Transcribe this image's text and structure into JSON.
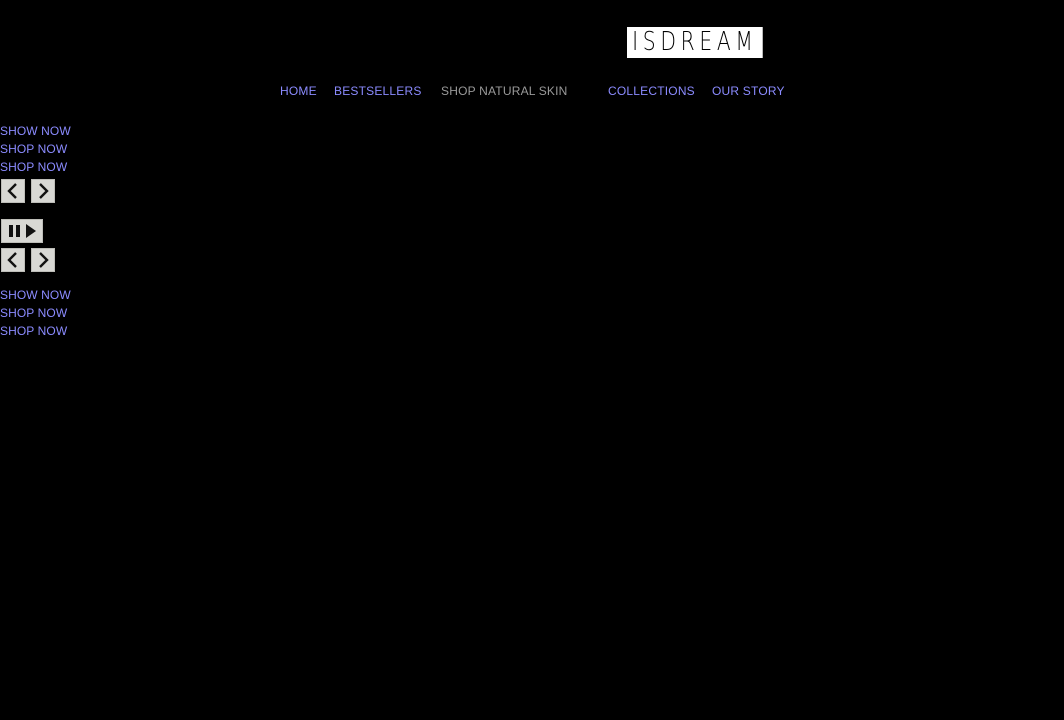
{
  "brand": {
    "logo_text": "ISDREAM"
  },
  "nav": {
    "items": [
      {
        "label": "HOME"
      },
      {
        "label": "BESTSELLERS"
      },
      {
        "label": "SHOP NATURAL SKIN"
      },
      {
        "label": "COLLECTIONS"
      },
      {
        "label": "OUR STORY"
      }
    ]
  },
  "carousel_top": {
    "links": [
      "SHOW NOW",
      "SHOP NOW",
      "SHOP NOW"
    ]
  },
  "carousel_bottom": {
    "links": [
      "SHOW NOW",
      "SHOP NOW",
      "SHOP NOW"
    ]
  },
  "controls": {
    "prev_icon": "chevron-left-icon",
    "next_icon": "chevron-right-icon",
    "pause_icon": "pause-icon",
    "play_icon": "play-icon"
  },
  "colors": {
    "background": "#000000",
    "link": "#8b8bff",
    "muted_link": "#9a9a9a",
    "button_face": "#d8d8d4"
  }
}
